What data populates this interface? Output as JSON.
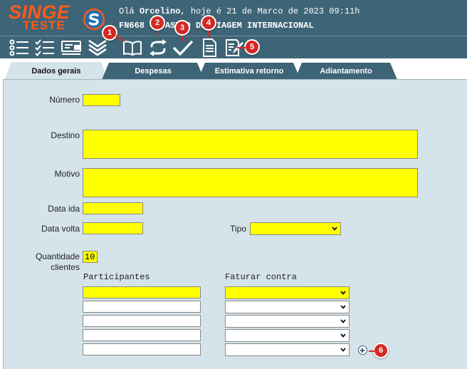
{
  "header": {
    "logo_top": "SINGE",
    "logo_bottom": "TESTE",
    "greeting_prefix": "Olá ",
    "user_name": "Orcelino",
    "greeting_suffix": ", hoje é 21 de Marco de 2023 09:11h",
    "screen_code": "FN668",
    "screen_title": "CADASTRO DE VIAGEM INTERNACIONAL",
    "background_color": "#3e6477",
    "logo_color": "#ff5a18"
  },
  "toolbar": {
    "buttons": [
      {
        "name": "list-icon",
        "badge": ""
      },
      {
        "name": "checklist-icon",
        "badge": ""
      },
      {
        "name": "card-icon",
        "badge": ""
      },
      {
        "name": "chevrons-down-icon",
        "badge": ""
      },
      {
        "name": "book-icon",
        "badge": "1"
      },
      {
        "name": "refresh-icon",
        "badge": "2"
      },
      {
        "name": "check-icon",
        "badge": "3"
      },
      {
        "name": "document-icon",
        "badge": "4"
      },
      {
        "name": "edit-icon",
        "badge": "5"
      }
    ]
  },
  "tabs": [
    {
      "label": "Dados gerais",
      "active": true
    },
    {
      "label": "Despesas",
      "active": false
    },
    {
      "label": "Estimativa retorno",
      "active": false
    },
    {
      "label": "Adiantamento",
      "active": false
    }
  ],
  "form": {
    "numero_label": "Número",
    "numero_value": "",
    "destino_label": "Destino",
    "destino_value": "",
    "motivo_label": "Motivo",
    "motivo_value": "",
    "data_ida_label": "Data ida",
    "data_ida_value": "",
    "data_volta_label": "Data volta",
    "data_volta_value": "",
    "tipo_label": "Tipo",
    "tipo_value": "",
    "quantidade_label_1": "Quantidade",
    "quantidade_label_2": "clientes",
    "quantidade_value": "10",
    "participantes_header": "Participantes",
    "faturar_header": "Faturar contra",
    "rows": [
      {
        "participante": "",
        "faturar": "",
        "highlight": true
      },
      {
        "participante": "",
        "faturar": "",
        "highlight": false
      },
      {
        "participante": "",
        "faturar": "",
        "highlight": false
      },
      {
        "participante": "",
        "faturar": "",
        "highlight": false
      },
      {
        "participante": "",
        "faturar": "",
        "highlight": false
      }
    ],
    "add_badge": "6",
    "required_color": "#ffff00",
    "panel_color": "#d5e3ea"
  }
}
